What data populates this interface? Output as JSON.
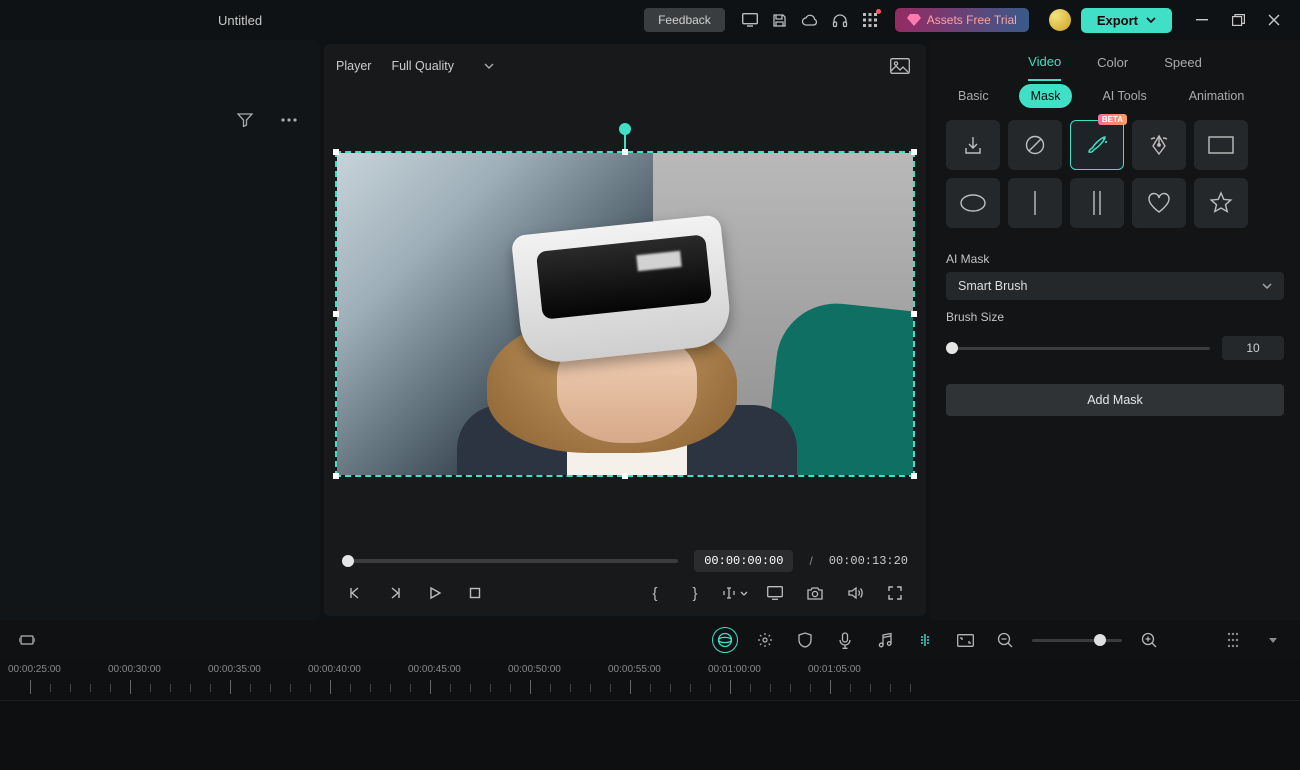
{
  "title": "Untitled",
  "titlebar": {
    "feedback": "Feedback",
    "assets_trial": "Assets Free Trial",
    "export": "Export"
  },
  "player": {
    "label": "Player",
    "quality": "Full Quality",
    "current_time": "00:00:00:00",
    "separator": "/",
    "duration": "00:00:13:20"
  },
  "tabs": {
    "video": "Video",
    "color": "Color",
    "speed": "Speed"
  },
  "subtabs": {
    "basic": "Basic",
    "mask": "Mask",
    "ai_tools": "AI Tools",
    "animation": "Animation"
  },
  "mask_badges": {
    "beta": "BETA"
  },
  "ai_mask": {
    "label": "AI Mask",
    "option": "Smart Brush"
  },
  "brush": {
    "label": "Brush Size",
    "value": "10"
  },
  "add_mask": "Add Mask",
  "ruler": [
    "00:00:25:00",
    "00:00:30:00",
    "00:00:35:00",
    "00:00:40:00",
    "00:00:45:00",
    "00:00:50:00",
    "00:00:55:00",
    "00:01:00:00",
    "00:01:05:00"
  ],
  "transport_glyphs": {
    "mark_in": "{",
    "mark_out": "}"
  }
}
